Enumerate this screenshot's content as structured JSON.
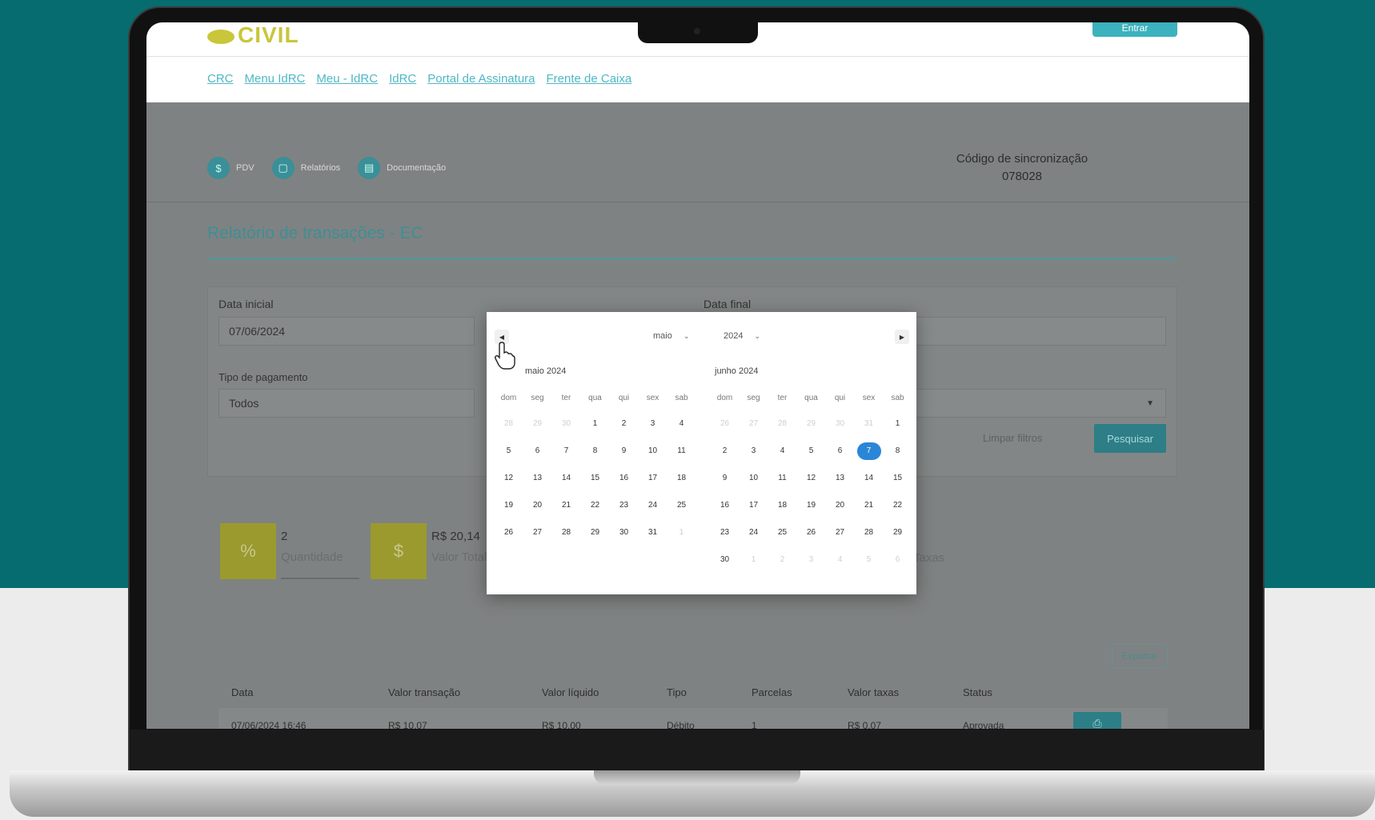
{
  "header": {
    "logo_text": "CIVIL",
    "enter_label": "Entrar",
    "nav_links": [
      "CRC",
      "Menu IdRC",
      "Meu - IdRC",
      "IdRC",
      "Portal de Assinatura",
      "Frente de Caixa"
    ]
  },
  "subnav": [
    {
      "icon": "dollar-icon",
      "glyph": "$",
      "label": "PDV"
    },
    {
      "icon": "report-icon",
      "glyph": "▢",
      "label": "Relatórios"
    },
    {
      "icon": "document-icon",
      "glyph": "▤",
      "label": "Documentação"
    }
  ],
  "sync": {
    "label": "Código de sincronização",
    "code": "078028"
  },
  "page_title": "Relatório de transações - EC",
  "filters": {
    "start_label": "Data inicial",
    "start_value": "07/06/2024",
    "end_label": "Data final",
    "payment_label": "Tipo de pagamento",
    "payment_value": "Todos",
    "clear_label": "Limpar filtros",
    "search_label": "Pesquisar"
  },
  "stats": [
    {
      "glyph": "%",
      "value": "2",
      "label": "Quantidade"
    },
    {
      "glyph": "$",
      "value": "R$ 20,14",
      "label": "Valor Total"
    },
    {
      "label": "Taxas"
    }
  ],
  "export_label": "Exportar",
  "table": {
    "headers": [
      "Data",
      "Valor transação",
      "Valor líquido",
      "Tipo",
      "Parcelas",
      "Valor taxas",
      "Status"
    ],
    "rows": [
      [
        "07/06/2024 16:46",
        "R$ 10,07",
        "R$ 10,00",
        "Débito",
        "1",
        "R$ 0,07",
        "Aprovada"
      ]
    ]
  },
  "datepicker": {
    "month_select": "maio",
    "year_select": "2024",
    "weekdays": [
      "dom",
      "seg",
      "ter",
      "qua",
      "qui",
      "sex",
      "sab"
    ],
    "months": [
      {
        "title": "maio 2024",
        "weeks": [
          [
            "28",
            "29",
            "30",
            "1",
            "2",
            "3",
            "4"
          ],
          [
            "5",
            "6",
            "7",
            "8",
            "9",
            "10",
            "11"
          ],
          [
            "12",
            "13",
            "14",
            "15",
            "16",
            "17",
            "18"
          ],
          [
            "19",
            "20",
            "21",
            "22",
            "23",
            "24",
            "25"
          ],
          [
            "26",
            "27",
            "28",
            "29",
            "30",
            "31",
            "1"
          ]
        ],
        "muted": [
          [
            0,
            0
          ],
          [
            0,
            1
          ],
          [
            0,
            2
          ],
          [
            4,
            6
          ]
        ]
      },
      {
        "title": "junho 2024",
        "weeks": [
          [
            "26",
            "27",
            "28",
            "29",
            "30",
            "31",
            "1"
          ],
          [
            "2",
            "3",
            "4",
            "5",
            "6",
            "7",
            "8"
          ],
          [
            "9",
            "10",
            "11",
            "12",
            "13",
            "14",
            "15"
          ],
          [
            "16",
            "17",
            "18",
            "19",
            "20",
            "21",
            "22"
          ],
          [
            "23",
            "24",
            "25",
            "26",
            "27",
            "28",
            "29"
          ],
          [
            "30",
            "1",
            "2",
            "3",
            "4",
            "5",
            "6"
          ]
        ],
        "muted": [
          [
            0,
            0
          ],
          [
            0,
            1
          ],
          [
            0,
            2
          ],
          [
            0,
            3
          ],
          [
            0,
            4
          ],
          [
            0,
            5
          ],
          [
            5,
            1
          ],
          [
            5,
            2
          ],
          [
            5,
            3
          ],
          [
            5,
            4
          ],
          [
            5,
            5
          ],
          [
            5,
            6
          ]
        ],
        "selected": [
          1,
          5
        ]
      }
    ]
  }
}
